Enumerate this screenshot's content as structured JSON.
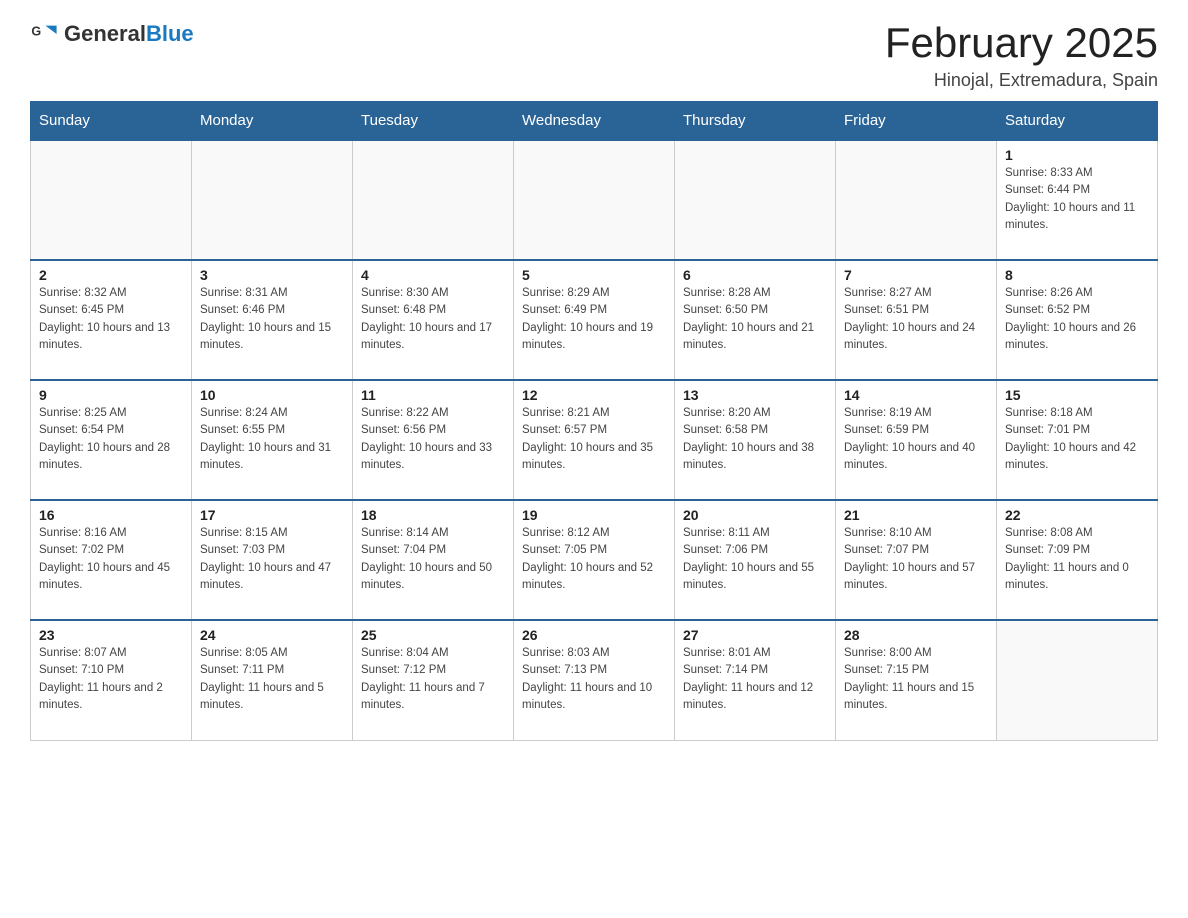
{
  "logo": {
    "general": "General",
    "blue": "Blue"
  },
  "header": {
    "month": "February 2025",
    "location": "Hinojal, Extremadura, Spain"
  },
  "days_of_week": [
    "Sunday",
    "Monday",
    "Tuesday",
    "Wednesday",
    "Thursday",
    "Friday",
    "Saturday"
  ],
  "weeks": [
    [
      {
        "date": "",
        "info": ""
      },
      {
        "date": "",
        "info": ""
      },
      {
        "date": "",
        "info": ""
      },
      {
        "date": "",
        "info": ""
      },
      {
        "date": "",
        "info": ""
      },
      {
        "date": "",
        "info": ""
      },
      {
        "date": "1",
        "info": "Sunrise: 8:33 AM\nSunset: 6:44 PM\nDaylight: 10 hours and 11 minutes."
      }
    ],
    [
      {
        "date": "2",
        "info": "Sunrise: 8:32 AM\nSunset: 6:45 PM\nDaylight: 10 hours and 13 minutes."
      },
      {
        "date": "3",
        "info": "Sunrise: 8:31 AM\nSunset: 6:46 PM\nDaylight: 10 hours and 15 minutes."
      },
      {
        "date": "4",
        "info": "Sunrise: 8:30 AM\nSunset: 6:48 PM\nDaylight: 10 hours and 17 minutes."
      },
      {
        "date": "5",
        "info": "Sunrise: 8:29 AM\nSunset: 6:49 PM\nDaylight: 10 hours and 19 minutes."
      },
      {
        "date": "6",
        "info": "Sunrise: 8:28 AM\nSunset: 6:50 PM\nDaylight: 10 hours and 21 minutes."
      },
      {
        "date": "7",
        "info": "Sunrise: 8:27 AM\nSunset: 6:51 PM\nDaylight: 10 hours and 24 minutes."
      },
      {
        "date": "8",
        "info": "Sunrise: 8:26 AM\nSunset: 6:52 PM\nDaylight: 10 hours and 26 minutes."
      }
    ],
    [
      {
        "date": "9",
        "info": "Sunrise: 8:25 AM\nSunset: 6:54 PM\nDaylight: 10 hours and 28 minutes."
      },
      {
        "date": "10",
        "info": "Sunrise: 8:24 AM\nSunset: 6:55 PM\nDaylight: 10 hours and 31 minutes."
      },
      {
        "date": "11",
        "info": "Sunrise: 8:22 AM\nSunset: 6:56 PM\nDaylight: 10 hours and 33 minutes."
      },
      {
        "date": "12",
        "info": "Sunrise: 8:21 AM\nSunset: 6:57 PM\nDaylight: 10 hours and 35 minutes."
      },
      {
        "date": "13",
        "info": "Sunrise: 8:20 AM\nSunset: 6:58 PM\nDaylight: 10 hours and 38 minutes."
      },
      {
        "date": "14",
        "info": "Sunrise: 8:19 AM\nSunset: 6:59 PM\nDaylight: 10 hours and 40 minutes."
      },
      {
        "date": "15",
        "info": "Sunrise: 8:18 AM\nSunset: 7:01 PM\nDaylight: 10 hours and 42 minutes."
      }
    ],
    [
      {
        "date": "16",
        "info": "Sunrise: 8:16 AM\nSunset: 7:02 PM\nDaylight: 10 hours and 45 minutes."
      },
      {
        "date": "17",
        "info": "Sunrise: 8:15 AM\nSunset: 7:03 PM\nDaylight: 10 hours and 47 minutes."
      },
      {
        "date": "18",
        "info": "Sunrise: 8:14 AM\nSunset: 7:04 PM\nDaylight: 10 hours and 50 minutes."
      },
      {
        "date": "19",
        "info": "Sunrise: 8:12 AM\nSunset: 7:05 PM\nDaylight: 10 hours and 52 minutes."
      },
      {
        "date": "20",
        "info": "Sunrise: 8:11 AM\nSunset: 7:06 PM\nDaylight: 10 hours and 55 minutes."
      },
      {
        "date": "21",
        "info": "Sunrise: 8:10 AM\nSunset: 7:07 PM\nDaylight: 10 hours and 57 minutes."
      },
      {
        "date": "22",
        "info": "Sunrise: 8:08 AM\nSunset: 7:09 PM\nDaylight: 11 hours and 0 minutes."
      }
    ],
    [
      {
        "date": "23",
        "info": "Sunrise: 8:07 AM\nSunset: 7:10 PM\nDaylight: 11 hours and 2 minutes."
      },
      {
        "date": "24",
        "info": "Sunrise: 8:05 AM\nSunset: 7:11 PM\nDaylight: 11 hours and 5 minutes."
      },
      {
        "date": "25",
        "info": "Sunrise: 8:04 AM\nSunset: 7:12 PM\nDaylight: 11 hours and 7 minutes."
      },
      {
        "date": "26",
        "info": "Sunrise: 8:03 AM\nSunset: 7:13 PM\nDaylight: 11 hours and 10 minutes."
      },
      {
        "date": "27",
        "info": "Sunrise: 8:01 AM\nSunset: 7:14 PM\nDaylight: 11 hours and 12 minutes."
      },
      {
        "date": "28",
        "info": "Sunrise: 8:00 AM\nSunset: 7:15 PM\nDaylight: 11 hours and 15 minutes."
      },
      {
        "date": "",
        "info": ""
      }
    ]
  ]
}
